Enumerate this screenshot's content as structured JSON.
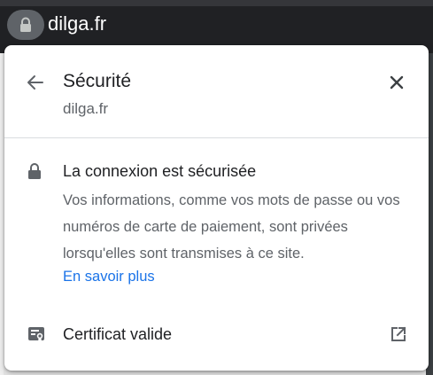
{
  "addressbar": {
    "url": "dilga.fr",
    "site_info_icon": "lock-icon"
  },
  "popup": {
    "title": "Sécurité",
    "subtitle": "dilga.fr",
    "back_icon": "arrow-left-icon",
    "close_icon": "close-icon",
    "connection": {
      "icon": "lock-icon",
      "title": "La connexion est sécurisée",
      "description": "Vos informations, comme vos mots de passe ou vos numéros de carte de paiement, sont privées lorsqu'elles sont transmises à ce site.",
      "learn_more": "En savoir plus"
    },
    "certificate": {
      "icon": "certificate-icon",
      "label": "Certificat valide",
      "external_icon": "external-link-icon"
    }
  },
  "colors": {
    "link": "#1a73e8",
    "text_primary": "#202124",
    "text_secondary": "#5f6368",
    "chrome_dark": "#202124"
  }
}
